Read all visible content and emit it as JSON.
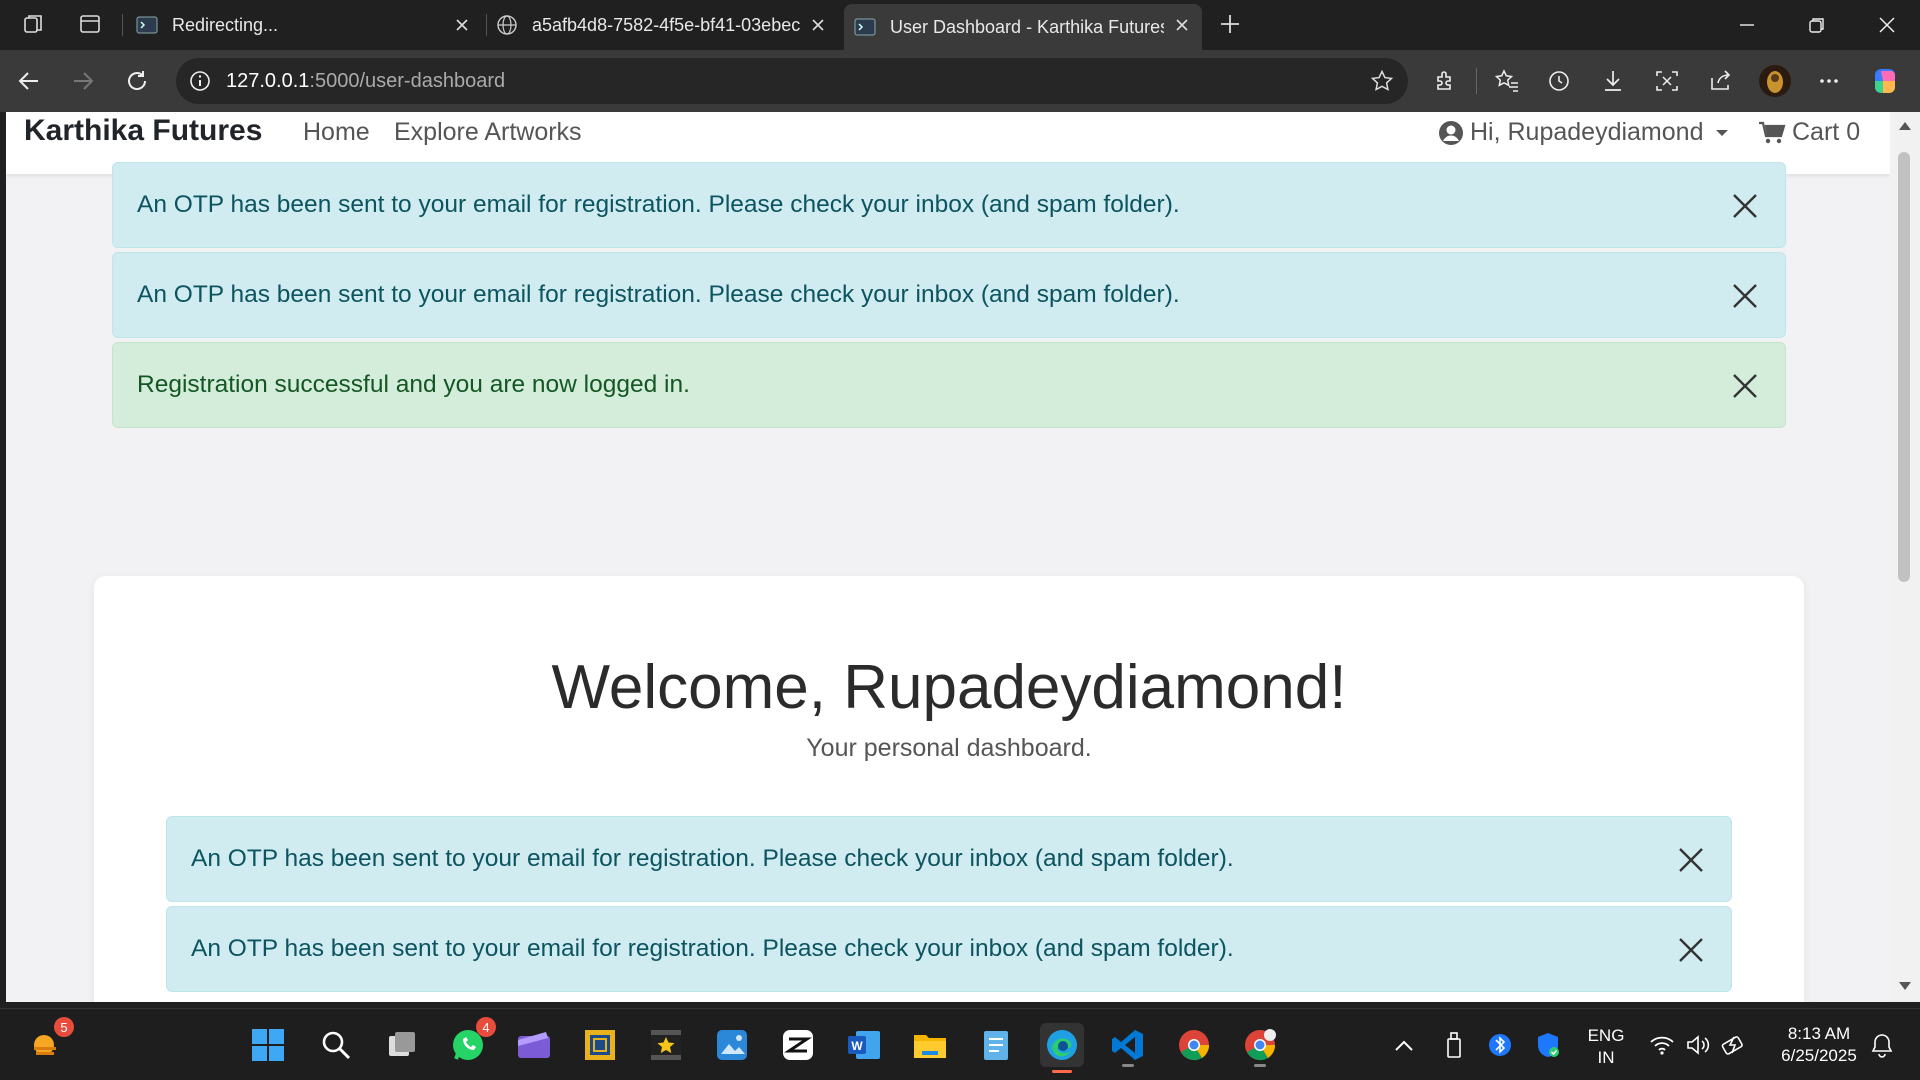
{
  "browser": {
    "tabs": [
      {
        "title": "Redirecting..."
      },
      {
        "title": "a5afb4d8-7582-4f5e-bf41-03ebec"
      },
      {
        "title": "User Dashboard - Karthika Futures"
      }
    ],
    "url_host": "127.0.0.1",
    "url_path": ":5000/user-dashboard"
  },
  "site": {
    "brand": "Karthika Futures",
    "nav": {
      "home": "Home",
      "explore": "Explore Artworks"
    },
    "user_greeting": "Hi, Rupadeydiamond",
    "cart_label": "Cart",
    "cart_count": "0"
  },
  "alerts_top": [
    {
      "type": "info",
      "text": "An OTP has been sent to your email for registration. Please check your inbox (and spam folder)."
    },
    {
      "type": "info",
      "text": "An OTP has been sent to your email for registration. Please check your inbox (and spam folder)."
    },
    {
      "type": "success",
      "text": "Registration successful and you are now logged in."
    }
  ],
  "dashboard": {
    "welcome": "Welcome, Rupadeydiamond!",
    "subtitle": "Your personal dashboard.",
    "alerts": [
      {
        "type": "info",
        "text": "An OTP has been sent to your email for registration. Please check your inbox (and spam folder)."
      },
      {
        "type": "info",
        "text": "An OTP has been sent to your email for registration. Please check your inbox (and spam folder)."
      }
    ]
  },
  "taskbar": {
    "weather_badge": "5",
    "whatsapp_badge": "4",
    "lang_line1": "ENG",
    "lang_line2": "IN",
    "time": "8:13 AM",
    "date": "6/25/2025"
  },
  "colors": {
    "info_bg": "#d1ecf1",
    "info_text": "#0c5460",
    "success_bg": "#d4edda",
    "success_text": "#155724"
  }
}
